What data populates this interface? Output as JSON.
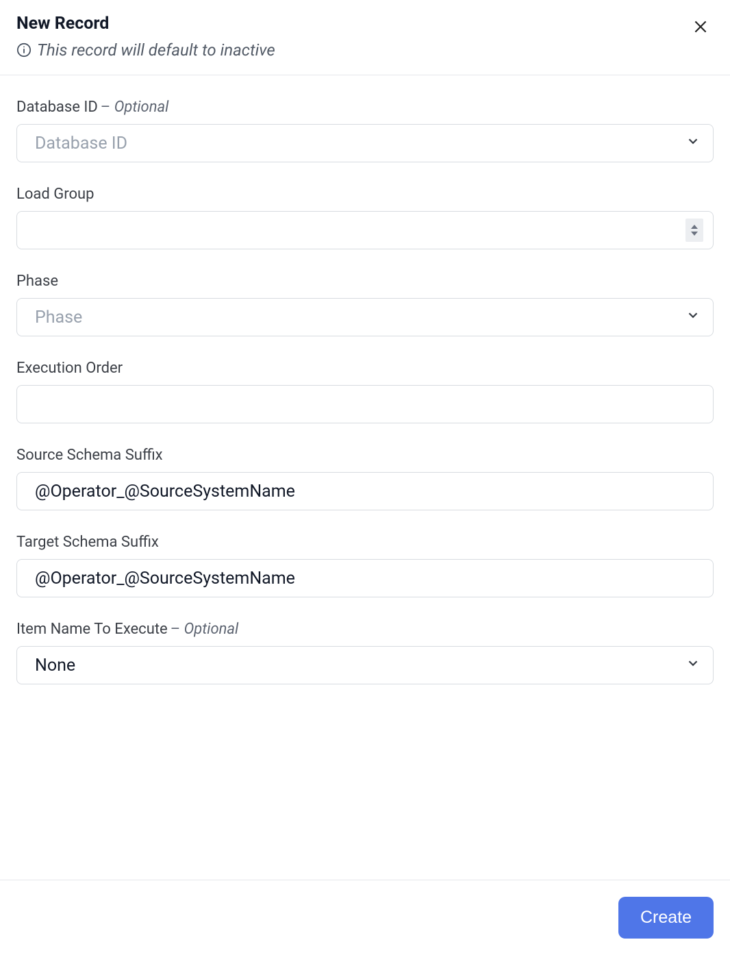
{
  "header": {
    "title": "New Record",
    "subtitle": "This record will default to inactive"
  },
  "optional_label": "Optional",
  "fields": {
    "database_id": {
      "label": "Database ID",
      "placeholder": "Database ID",
      "value": "",
      "optional": true
    },
    "load_group": {
      "label": "Load Group",
      "value": ""
    },
    "phase": {
      "label": "Phase",
      "placeholder": "Phase",
      "value": ""
    },
    "execution_order": {
      "label": "Execution Order",
      "value": ""
    },
    "source_schema_suffix": {
      "label": "Source Schema Suffix",
      "value": "@Operator_@SourceSystemName"
    },
    "target_schema_suffix": {
      "label": "Target Schema Suffix",
      "value": "@Operator_@SourceSystemName"
    },
    "item_name_to_execute": {
      "label": "Item Name To Execute",
      "value": "None",
      "optional": true
    }
  },
  "footer": {
    "create_label": "Create"
  }
}
